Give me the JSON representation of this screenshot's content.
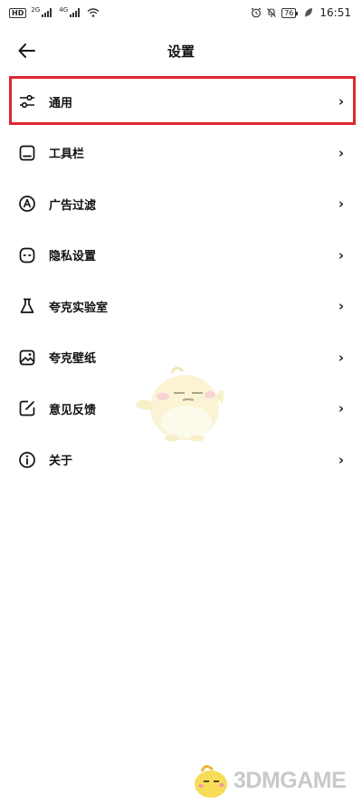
{
  "status_bar": {
    "hd_label": "HD",
    "network_1": "2G",
    "network_2": "4G",
    "battery": "76",
    "time": "16:51"
  },
  "header": {
    "back_icon": "arrow-left-icon",
    "title": "设置"
  },
  "settings": [
    {
      "label": "通用",
      "icon": "sliders-icon",
      "highlighted": true
    },
    {
      "label": "工具栏",
      "icon": "toolbar-icon"
    },
    {
      "label": "广告过滤",
      "icon": "ad-filter-icon"
    },
    {
      "label": "隐私设置",
      "icon": "privacy-icon"
    },
    {
      "label": "夸克实验室",
      "icon": "flask-icon"
    },
    {
      "label": "夸克壁纸",
      "icon": "wallpaper-icon"
    },
    {
      "label": "意见反馈",
      "icon": "feedback-icon"
    },
    {
      "label": "关于",
      "icon": "info-icon"
    }
  ],
  "chevron": "›",
  "watermark": {
    "brand": "3DMGAME"
  },
  "colors": {
    "highlight": "#e0262f",
    "text": "#111111",
    "background": "#ffffff"
  }
}
